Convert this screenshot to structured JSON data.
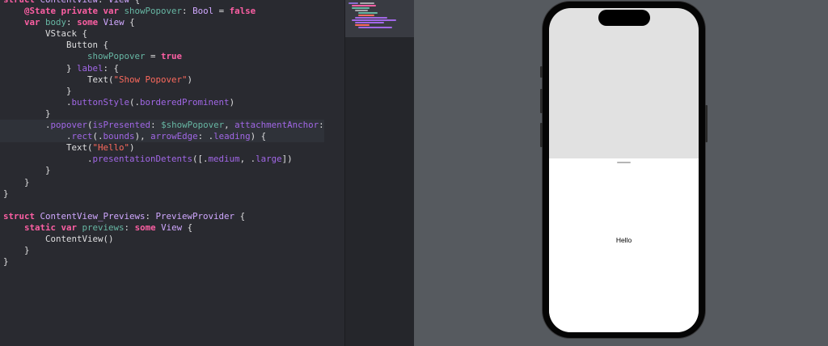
{
  "editor": {
    "lines": [
      [
        {
          "c": "kw",
          "t": "struct "
        },
        {
          "c": "ty",
          "t": "ContentView"
        },
        {
          "c": "plain",
          "t": ": "
        },
        {
          "c": "ty",
          "t": "View"
        },
        {
          "c": "plain",
          "t": " {"
        }
      ],
      [
        {
          "c": "plain",
          "t": "    "
        },
        {
          "c": "kw",
          "t": "@State private var "
        },
        {
          "c": "prop",
          "t": "showPopover"
        },
        {
          "c": "plain",
          "t": ": "
        },
        {
          "c": "ty",
          "t": "Bool"
        },
        {
          "c": "plain",
          "t": " = "
        },
        {
          "c": "kw",
          "t": "false"
        }
      ],
      [
        {
          "c": "plain",
          "t": "    "
        },
        {
          "c": "kw",
          "t": "var "
        },
        {
          "c": "prop",
          "t": "body"
        },
        {
          "c": "plain",
          "t": ": "
        },
        {
          "c": "kw",
          "t": "some "
        },
        {
          "c": "ty",
          "t": "View"
        },
        {
          "c": "plain",
          "t": " {"
        }
      ],
      [
        {
          "c": "plain",
          "t": "        VStack {"
        }
      ],
      [
        {
          "c": "plain",
          "t": "            Button {"
        }
      ],
      [
        {
          "c": "plain",
          "t": "                "
        },
        {
          "c": "prop",
          "t": "showPopover"
        },
        {
          "c": "plain",
          "t": " = "
        },
        {
          "c": "kw",
          "t": "true"
        }
      ],
      [
        {
          "c": "plain",
          "t": "            } "
        },
        {
          "c": "fn",
          "t": "label"
        },
        {
          "c": "plain",
          "t": ": {"
        }
      ],
      [
        {
          "c": "plain",
          "t": "                Text("
        },
        {
          "c": "str",
          "t": "\"Show Popover\""
        },
        {
          "c": "plain",
          "t": ")"
        }
      ],
      [
        {
          "c": "plain",
          "t": "            }"
        }
      ],
      [
        {
          "c": "plain",
          "t": "            ."
        },
        {
          "c": "fn",
          "t": "buttonStyle"
        },
        {
          "c": "plain",
          "t": "(."
        },
        {
          "c": "fn",
          "t": "borderedProminent"
        },
        {
          "c": "plain",
          "t": ")"
        }
      ],
      [
        {
          "c": "plain",
          "t": "        }"
        }
      ],
      [
        {
          "c": "plain",
          "t": "        ."
        },
        {
          "c": "fn",
          "t": "popover"
        },
        {
          "c": "plain",
          "t": "("
        },
        {
          "c": "fn",
          "t": "isPresented"
        },
        {
          "c": "plain",
          "t": ": "
        },
        {
          "c": "prop",
          "t": "$showPopover"
        },
        {
          "c": "plain",
          "t": ", "
        },
        {
          "c": "fn",
          "t": "attachmentAnchor"
        },
        {
          "c": "plain",
          "t": ":"
        }
      ],
      [
        {
          "c": "plain",
          "t": "            ."
        },
        {
          "c": "fn",
          "t": "rect"
        },
        {
          "c": "plain",
          "t": "(."
        },
        {
          "c": "fn",
          "t": "bounds"
        },
        {
          "c": "plain",
          "t": "), "
        },
        {
          "c": "fn",
          "t": "arrowEdge"
        },
        {
          "c": "plain",
          "t": ": ."
        },
        {
          "c": "fn",
          "t": "leading"
        },
        {
          "c": "plain",
          "t": ") {"
        }
      ],
      [
        {
          "c": "plain",
          "t": "            Text("
        },
        {
          "c": "str",
          "t": "\"Hello\""
        },
        {
          "c": "plain",
          "t": ")"
        }
      ],
      [
        {
          "c": "plain",
          "t": "                ."
        },
        {
          "c": "fn",
          "t": "presentationDetents"
        },
        {
          "c": "plain",
          "t": "([."
        },
        {
          "c": "fn",
          "t": "medium"
        },
        {
          "c": "plain",
          "t": ", ."
        },
        {
          "c": "fn",
          "t": "large"
        },
        {
          "c": "plain",
          "t": "])"
        }
      ],
      [
        {
          "c": "plain",
          "t": "        }"
        }
      ],
      [
        {
          "c": "plain",
          "t": "    }"
        }
      ],
      [
        {
          "c": "plain",
          "t": "}"
        }
      ],
      [
        {
          "c": "plain",
          "t": ""
        }
      ],
      [
        {
          "c": "kw",
          "t": "struct "
        },
        {
          "c": "ty",
          "t": "ContentView_Previews"
        },
        {
          "c": "plain",
          "t": ": "
        },
        {
          "c": "ty",
          "t": "PreviewProvider"
        },
        {
          "c": "plain",
          "t": " {"
        }
      ],
      [
        {
          "c": "plain",
          "t": "    "
        },
        {
          "c": "kw",
          "t": "static var "
        },
        {
          "c": "prop",
          "t": "previews"
        },
        {
          "c": "plain",
          "t": ": "
        },
        {
          "c": "kw",
          "t": "some "
        },
        {
          "c": "ty",
          "t": "View"
        },
        {
          "c": "plain",
          "t": " {"
        }
      ],
      [
        {
          "c": "plain",
          "t": "        ContentView()"
        }
      ],
      [
        {
          "c": "plain",
          "t": "    }"
        }
      ],
      [
        {
          "c": "plain",
          "t": "}"
        }
      ]
    ],
    "highlighted_lines": [
      11,
      12
    ]
  },
  "preview": {
    "sheet_text": "Hello"
  },
  "colors": {
    "editor_bg": "#292a30",
    "keyword": "#fc5fa3",
    "type": "#d0a8ff",
    "function": "#a167e6",
    "property": "#67b7a4",
    "string": "#fc6a5d",
    "preview_bg": "#565a5f",
    "sheet_bg": "#ffffff"
  }
}
